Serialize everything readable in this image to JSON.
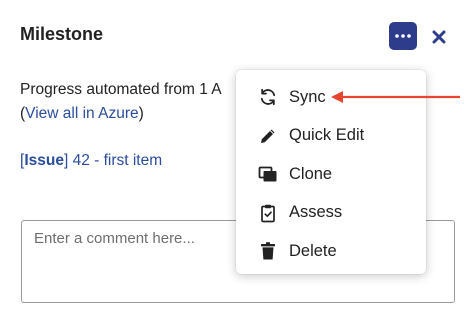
{
  "header": {
    "title": "Milestone",
    "more_icon": "more-horizontal-icon",
    "close_icon": "close-x-icon"
  },
  "body": {
    "progress_text": "Progress automated from 1 A",
    "paren_open": "(",
    "view_all_link": "View all in Azure",
    "paren_close": ")",
    "issue": {
      "open_bracket": "[",
      "tag": "Issue",
      "close_bracket": "]",
      "text": " 42 - first item"
    }
  },
  "comment": {
    "placeholder": "Enter a comment here..."
  },
  "menu": {
    "items": [
      {
        "label": "Sync",
        "icon": "sync-icon"
      },
      {
        "label": "Quick Edit",
        "icon": "pencil-icon"
      },
      {
        "label": "Clone",
        "icon": "clone-icon"
      },
      {
        "label": "Assess",
        "icon": "clipboard-check-icon"
      },
      {
        "label": "Delete",
        "icon": "trash-icon"
      }
    ]
  },
  "colors": {
    "accent_button": "#2e3c8c",
    "link": "#2a4d9c",
    "annotation_arrow": "#e8442e"
  }
}
